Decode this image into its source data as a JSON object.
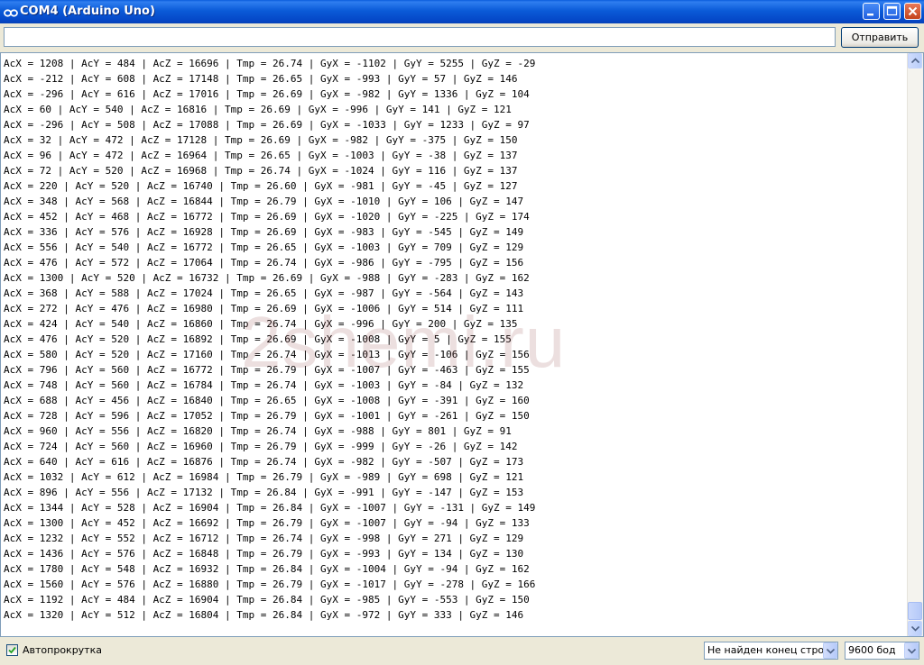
{
  "window": {
    "title": "COM4 (Arduino Uno)"
  },
  "send": {
    "input_value": "",
    "button_label": "Отправить"
  },
  "output": {
    "watermark": "2shemi.ru",
    "lines": [
      "AcX = 1208 | AcY = 484 | AcZ = 16696 | Tmp = 26.74 | GyX = -1102 | GyY = 5255 | GyZ = -29",
      "AcX = -212 | AcY = 608 | AcZ = 17148 | Tmp = 26.65 | GyX = -993 | GyY = 57 | GyZ = 146",
      "AcX = -296 | AcY = 616 | AcZ = 17016 | Tmp = 26.69 | GyX = -982 | GyY = 1336 | GyZ = 104",
      "AcX = 60 | AcY = 540 | AcZ = 16816 | Tmp = 26.69 | GyX = -996 | GyY = 141 | GyZ = 121",
      "AcX = -296 | AcY = 508 | AcZ = 17088 | Tmp = 26.69 | GyX = -1033 | GyY = 1233 | GyZ = 97",
      "AcX = 32 | AcY = 472 | AcZ = 17128 | Tmp = 26.69 | GyX = -982 | GyY = -375 | GyZ = 150",
      "AcX = 96 | AcY = 472 | AcZ = 16964 | Tmp = 26.65 | GyX = -1003 | GyY = -38 | GyZ = 137",
      "AcX = 72 | AcY = 520 | AcZ = 16968 | Tmp = 26.74 | GyX = -1024 | GyY = 116 | GyZ = 137",
      "AcX = 220 | AcY = 520 | AcZ = 16740 | Tmp = 26.60 | GyX = -981 | GyY = -45 | GyZ = 127",
      "AcX = 348 | AcY = 568 | AcZ = 16844 | Tmp = 26.79 | GyX = -1010 | GyY = 106 | GyZ = 147",
      "AcX = 452 | AcY = 468 | AcZ = 16772 | Tmp = 26.69 | GyX = -1020 | GyY = -225 | GyZ = 174",
      "AcX = 336 | AcY = 576 | AcZ = 16928 | Tmp = 26.69 | GyX = -983 | GyY = -545 | GyZ = 149",
      "AcX = 556 | AcY = 540 | AcZ = 16772 | Tmp = 26.65 | GyX = -1003 | GyY = 709 | GyZ = 129",
      "AcX = 476 | AcY = 572 | AcZ = 17064 | Tmp = 26.74 | GyX = -986 | GyY = -795 | GyZ = 156",
      "AcX = 1300 | AcY = 520 | AcZ = 16732 | Tmp = 26.69 | GyX = -988 | GyY = -283 | GyZ = 162",
      "AcX = 368 | AcY = 588 | AcZ = 17024 | Tmp = 26.65 | GyX = -987 | GyY = -564 | GyZ = 143",
      "AcX = 272 | AcY = 476 | AcZ = 16980 | Tmp = 26.69 | GyX = -1006 | GyY = 514 | GyZ = 111",
      "AcX = 424 | AcY = 540 | AcZ = 16860 | Tmp = 26.74 | GyX = -996 | GyY = 200 | GyZ = 135",
      "AcX = 476 | AcY = 520 | AcZ = 16892 | Tmp = 26.69 | GyX = -1008 | GyY = 5 | GyZ = 155",
      "AcX = 580 | AcY = 520 | AcZ = 17160 | Tmp = 26.74 | GyX = -1013 | GyY = -106 | GyZ = 156",
      "AcX = 796 | AcY = 560 | AcZ = 16772 | Tmp = 26.79 | GyX = -1007 | GyY = -463 | GyZ = 155",
      "AcX = 748 | AcY = 560 | AcZ = 16784 | Tmp = 26.74 | GyX = -1003 | GyY = -84 | GyZ = 132",
      "AcX = 688 | AcY = 456 | AcZ = 16840 | Tmp = 26.65 | GyX = -1008 | GyY = -391 | GyZ = 160",
      "AcX = 728 | AcY = 596 | AcZ = 17052 | Tmp = 26.79 | GyX = -1001 | GyY = -261 | GyZ = 150",
      "AcX = 960 | AcY = 556 | AcZ = 16820 | Tmp = 26.74 | GyX = -988 | GyY = 801 | GyZ = 91",
      "AcX = 724 | AcY = 560 | AcZ = 16960 | Tmp = 26.79 | GyX = -999 | GyY = -26 | GyZ = 142",
      "AcX = 640 | AcY = 616 | AcZ = 16876 | Tmp = 26.74 | GyX = -982 | GyY = -507 | GyZ = 173",
      "AcX = 1032 | AcY = 612 | AcZ = 16984 | Tmp = 26.79 | GyX = -989 | GyY = 698 | GyZ = 121",
      "AcX = 896 | AcY = 556 | AcZ = 17132 | Tmp = 26.84 | GyX = -991 | GyY = -147 | GyZ = 153",
      "AcX = 1344 | AcY = 528 | AcZ = 16904 | Tmp = 26.84 | GyX = -1007 | GyY = -131 | GyZ = 149",
      "AcX = 1300 | AcY = 452 | AcZ = 16692 | Tmp = 26.79 | GyX = -1007 | GyY = -94 | GyZ = 133",
      "AcX = 1232 | AcY = 552 | AcZ = 16712 | Tmp = 26.74 | GyX = -998 | GyY = 271 | GyZ = 129",
      "AcX = 1436 | AcY = 576 | AcZ = 16848 | Tmp = 26.79 | GyX = -993 | GyY = 134 | GyZ = 130",
      "AcX = 1780 | AcY = 548 | AcZ = 16932 | Tmp = 26.84 | GyX = -1004 | GyY = -94 | GyZ = 162",
      "AcX = 1560 | AcY = 576 | AcZ = 16880 | Tmp = 26.79 | GyX = -1017 | GyY = -278 | GyZ = 166",
      "AcX = 1192 | AcY = 484 | AcZ = 16904 | Tmp = 26.84 | GyX = -985 | GyY = -553 | GyZ = 150",
      "AcX = 1320 | AcY = 512 | AcZ = 16804 | Tmp = 26.84 | GyX = -972 | GyY = 333 | GyZ = 146"
    ]
  },
  "footer": {
    "autoscroll_label": "Автопрокрутка",
    "autoscroll_checked": true,
    "line_ending": "Не найден конец строки",
    "baud_rate": "9600 бод"
  },
  "colors": {
    "titlebar": "#0b5bd8",
    "window_bg": "#ece9d8",
    "output_bg": "#ffffff"
  },
  "icons": {
    "app": "arduino-infinity-icon",
    "minimize": "minimize-icon",
    "maximize": "maximize-icon",
    "close": "close-icon"
  }
}
